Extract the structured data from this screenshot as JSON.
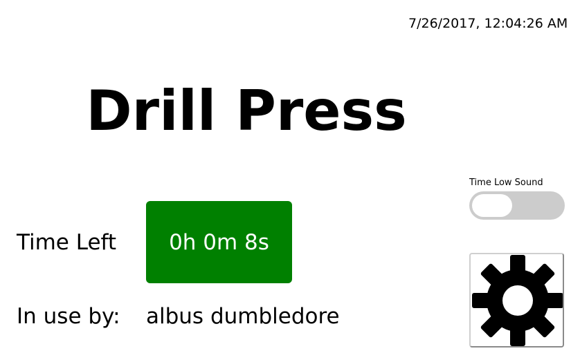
{
  "header": {
    "datetime": "7/26/2017, 12:04:26 AM",
    "machine_name": "Drill Press"
  },
  "time_low_sound": {
    "label": "Time Low Sound",
    "enabled": false
  },
  "session": {
    "time_left_label": "Time Left",
    "time_left_value": "0h 0m 8s",
    "in_use_label": "In use by:",
    "user_name": "albus dumbledore"
  },
  "settings": {
    "icon": "gear-icon"
  },
  "colors": {
    "time_left_background": "#008000",
    "time_left_text": "#ffffff",
    "toggle_track": "#cccccc",
    "toggle_knob": "#ffffff"
  }
}
